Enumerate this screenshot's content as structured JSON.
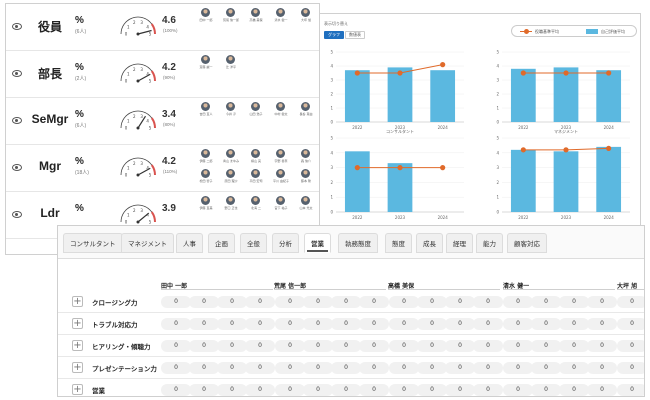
{
  "positions": [
    {
      "name": "役員",
      "percent": "%",
      "count": "(6人)",
      "score": "4.6",
      "ratio": "(100%)",
      "level": 0.92,
      "people": [
        "田中 一郎",
        "荒尾 信一郎",
        "高橋 美保",
        "清水 健一",
        "大坪 旭"
      ]
    },
    {
      "name": "部長",
      "percent": "%",
      "count": "(2人)",
      "score": "4.2",
      "ratio": "(90%)",
      "level": 0.84,
      "people": [
        "斎藤 誠一",
        "辻 洋平"
      ]
    },
    {
      "name": "SeMgr",
      "percent": "%",
      "count": "(6人)",
      "score": "3.4",
      "ratio": "(80%)",
      "level": 0.68,
      "people": [
        "吉田 直人",
        "今井 淳",
        "山田 浩子",
        "中村 健太",
        "長谷 真由"
      ]
    },
    {
      "name": "Mgr",
      "percent": "%",
      "count": "(18人)",
      "score": "4.2",
      "ratio": "(110%)",
      "level": 0.84,
      "people": [
        "伊藤 二郎",
        "青山 まゆみ",
        "横山 亮",
        "宇野 香奈",
        "森 信介",
        "松田 智子",
        "原田 理沙",
        "平田 宏司",
        "平川 由紀子",
        "藤本 隆"
      ]
    },
    {
      "name": "Ldr",
      "percent": "%",
      "count": "",
      "score": "3.9",
      "ratio": "",
      "level": 0.78,
      "people": [
        "伊藤 直美",
        "野口 正也",
        "北海 二",
        "宮下 祐子",
        "山本 光太"
      ]
    }
  ],
  "gauge_ticks": [
    "0",
    "1",
    "2",
    "3",
    "4",
    "5"
  ],
  "chart_panel": {
    "switch_label": "表示切り替え",
    "graph_button": "グラフ",
    "table_button": "数値表",
    "legend_line": "役職基準平均",
    "legend_bar": "自己評価平均",
    "bar_color": "#5bb8e0",
    "line_color": "#e06a2a"
  },
  "chart_data": [
    {
      "type": "bar",
      "title": "",
      "categories": [
        "2022",
        "2023",
        "2024"
      ],
      "values": [
        3.7,
        3.9,
        3.7
      ],
      "line": [
        3.5,
        3.5,
        4.1
      ],
      "ylim": [
        0,
        5
      ],
      "yticks": [
        "0",
        "1",
        "2",
        "3",
        "4",
        "5"
      ]
    },
    {
      "type": "bar",
      "title": "",
      "categories": [
        "2022",
        "2023",
        "2024"
      ],
      "values": [
        3.8,
        3.9,
        3.7
      ],
      "line": [
        3.5,
        3.5,
        3.5
      ],
      "ylim": [
        0,
        5
      ],
      "yticks": [
        "0",
        "1",
        "2",
        "3",
        "4",
        "5"
      ]
    },
    {
      "type": "bar",
      "title": "コンサルタント",
      "categories": [
        "2022",
        "2023",
        "2024"
      ],
      "values": [
        4.1,
        3.3,
        null
      ],
      "line": [
        3.0,
        3.0,
        3.0
      ],
      "ylim": [
        0,
        5
      ],
      "yticks": [
        "0",
        "1",
        "2",
        "3",
        "4",
        "5"
      ]
    },
    {
      "type": "bar",
      "title": "マネジメント",
      "categories": [
        "2022",
        "2023",
        "2024"
      ],
      "values": [
        4.2,
        4.1,
        4.4
      ],
      "line": [
        4.2,
        4.2,
        4.3
      ],
      "ylim": [
        0,
        5
      ],
      "yticks": [
        "0",
        "1",
        "2",
        "3",
        "4",
        "5"
      ]
    }
  ],
  "tabs": [
    "コンサルタント",
    "マネジメント",
    "人事",
    "企画",
    "全般",
    "分析",
    "営業",
    "執務態度",
    "態度",
    "成長",
    "経理",
    "能力",
    "顧客対応"
  ],
  "active_tab": 6,
  "people_header": [
    "田中 一郎",
    "荒尾 信一郎",
    "高橋 美保",
    "清水 健一",
    "大坪 旭"
  ],
  "skills": [
    {
      "name": "クロージング力",
      "values": [
        "0",
        "0",
        "0",
        "0",
        "0",
        "0",
        "0",
        "0",
        "0",
        "0",
        "0",
        "0",
        "0",
        "0",
        "0",
        "0",
        "0",
        "0",
        "0",
        "0",
        "0"
      ]
    },
    {
      "name": "トラブル対応力",
      "values": [
        "0",
        "0",
        "0",
        "0",
        "0",
        "0",
        "0",
        "0",
        "0",
        "0",
        "0",
        "0",
        "0",
        "0",
        "0",
        "0",
        "0",
        "0",
        "0",
        "0",
        "0"
      ]
    },
    {
      "name": "ヒアリング・傾聴力",
      "values": [
        "0",
        "0",
        "0",
        "0",
        "0",
        "0",
        "0",
        "0",
        "0",
        "0",
        "0",
        "0",
        "0",
        "0",
        "0",
        "0",
        "0",
        "0",
        "0",
        "0",
        "0"
      ]
    },
    {
      "name": "プレゼンテーション力",
      "values": [
        "0",
        "0",
        "0",
        "0",
        "0",
        "0",
        "0",
        "0",
        "0",
        "0",
        "0",
        "0",
        "0",
        "0",
        "0",
        "0",
        "0",
        "0",
        "0",
        "0",
        "0"
      ]
    },
    {
      "name": "営業",
      "values": [
        "0",
        "0",
        "0",
        "0",
        "0",
        "0",
        "0",
        "0",
        "0",
        "0",
        "0",
        "0",
        "0",
        "0",
        "0",
        "0",
        "0",
        "0",
        "0",
        "0",
        "0"
      ]
    }
  ]
}
